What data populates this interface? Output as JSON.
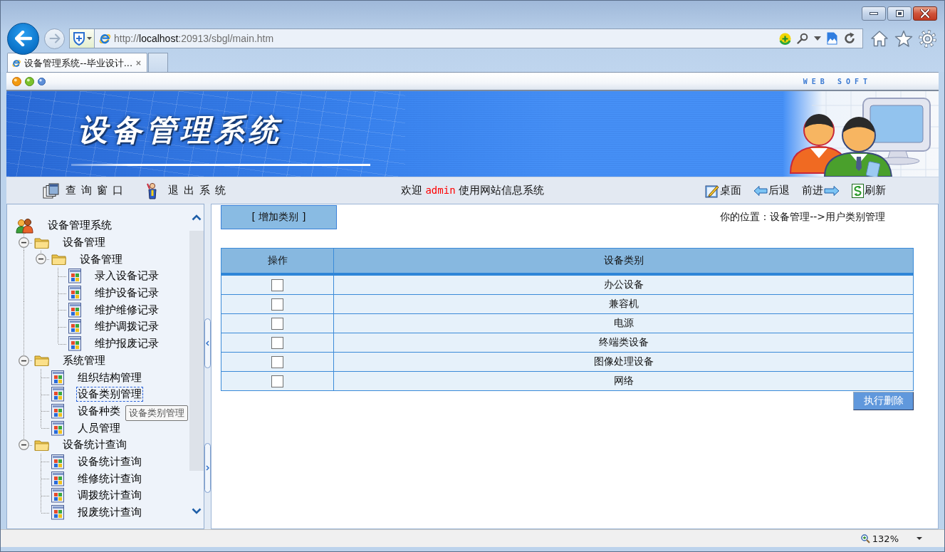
{
  "browser": {
    "address": {
      "scheme": "http://",
      "host": "localhost",
      "path": ":20913/sbgl/main.htm"
    },
    "tabs": [
      {
        "title": "设备管理系统--毕业设计...",
        "selected": true
      }
    ]
  },
  "page": {
    "brand": "WEB SOFT",
    "banner": {
      "title": "设备管理系统"
    },
    "nav": {
      "left_links": [
        {
          "label": "查询窗口",
          "kind": "windows"
        },
        {
          "label": "退出系统",
          "kind": "exit"
        }
      ],
      "welcome": {
        "greeting": "欢迎",
        "user": "admin",
        "message": "使用网站信息系统"
      },
      "right_links": [
        {
          "label": "桌面",
          "kind": "desktop"
        },
        {
          "label": "后退",
          "kind": "back"
        },
        {
          "label": "前进",
          "kind": "forward"
        },
        {
          "label": "刷新",
          "kind": "refresh"
        }
      ]
    }
  },
  "sidebar": {
    "tree": [
      {
        "label": "设备管理系统",
        "kind": "root",
        "selected": false,
        "children": [
          {
            "label": "设备管理",
            "kind": "folder",
            "expanded": true,
            "selected": false,
            "children": [
              {
                "label": "设备管理",
                "kind": "folder",
                "expanded": true,
                "selected": false,
                "children": [
                  {
                    "label": "录入设备记录",
                    "kind": "page",
                    "selected": false
                  },
                  {
                    "label": "维护设备记录",
                    "kind": "page",
                    "selected": false
                  },
                  {
                    "label": "维护维修记录",
                    "kind": "page",
                    "selected": false
                  },
                  {
                    "label": "维护调拨记录",
                    "kind": "page",
                    "selected": false
                  },
                  {
                    "label": "维护报废记录",
                    "kind": "page",
                    "selected": false
                  }
                ]
              }
            ]
          },
          {
            "label": "系统管理",
            "kind": "folder",
            "expanded": true,
            "selected": false,
            "children": [
              {
                "label": "组织结构管理",
                "kind": "page",
                "selected": false
              },
              {
                "label": "设备类别管理",
                "kind": "page",
                "selected": true,
                "tooltip": "设备类别管理"
              },
              {
                "label": "设备种类",
                "kind": "page",
                "selected": false
              },
              {
                "label": "人员管理",
                "kind": "page",
                "selected": false
              }
            ]
          },
          {
            "label": "设备统计查询",
            "kind": "folder",
            "expanded": true,
            "selected": false,
            "children": [
              {
                "label": "设备统计查询",
                "kind": "page",
                "selected": false
              },
              {
                "label": "维修统计查询",
                "kind": "page",
                "selected": false
              },
              {
                "label": "调拨统计查询",
                "kind": "page",
                "selected": false
              },
              {
                "label": "报废统计查询",
                "kind": "page",
                "selected": false
              }
            ]
          }
        ]
      }
    ]
  },
  "content": {
    "add_button": "[ 增加类别 ]",
    "breadcrumb": "你的位置：设备管理-->用户类别管理",
    "table": {
      "columns": [
        "操作",
        "设备类别"
      ],
      "rows": [
        {
          "checked": false,
          "category": "办公设备"
        },
        {
          "checked": false,
          "category": "兼容机"
        },
        {
          "checked": false,
          "category": "电源"
        },
        {
          "checked": false,
          "category": "终端类设备"
        },
        {
          "checked": false,
          "category": "图像处理设备"
        },
        {
          "checked": false,
          "category": "网络"
        }
      ]
    },
    "delete_button": "执行删除"
  },
  "status_bar": {
    "zoom": "132%"
  }
}
